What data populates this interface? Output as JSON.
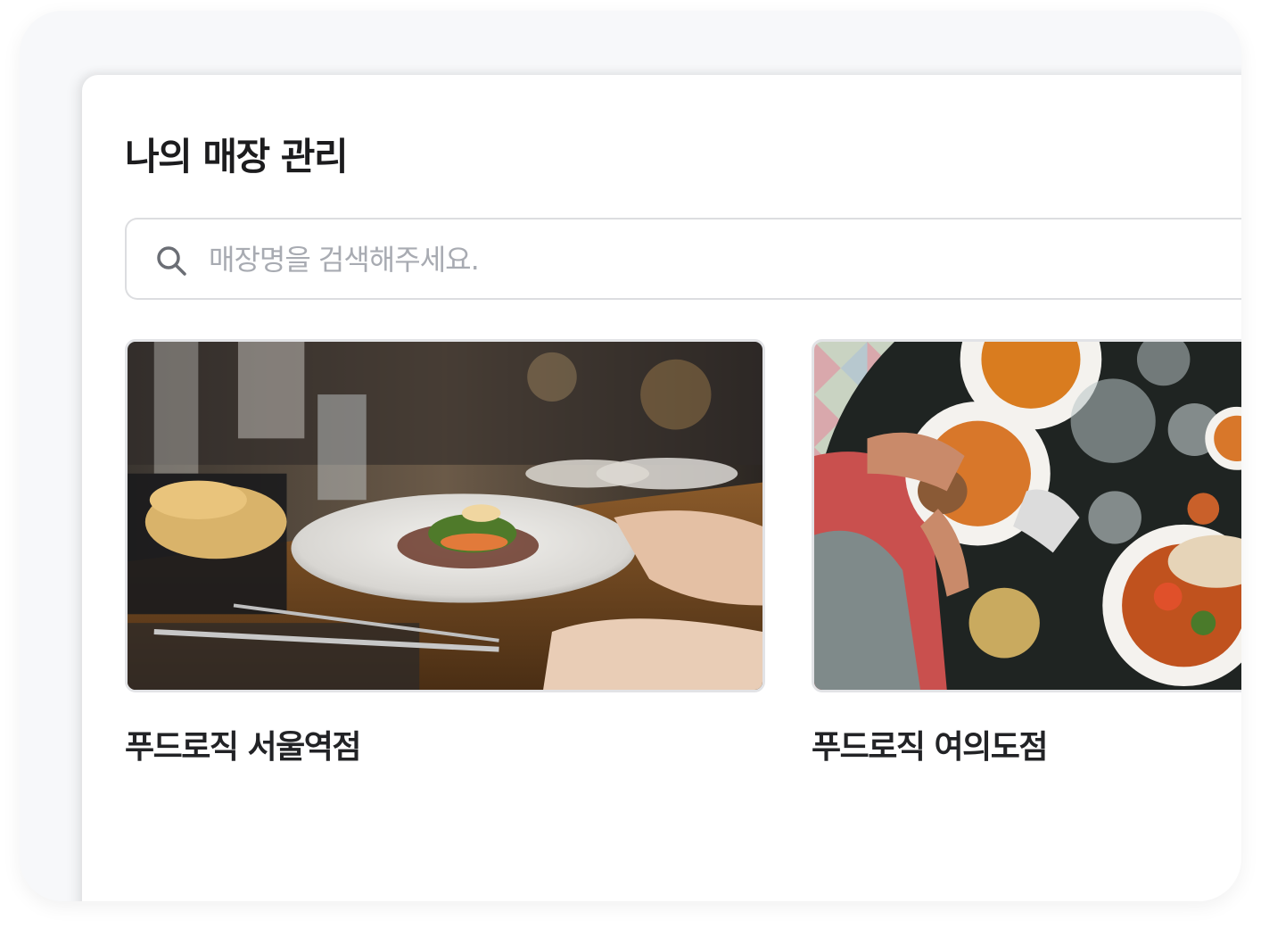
{
  "page": {
    "title": "나의 매장 관리"
  },
  "search": {
    "placeholder": "매장명을 검색해주세요.",
    "value": "",
    "icon": "search-icon"
  },
  "stores": [
    {
      "name": "푸드로직 서울역점",
      "image": "fine-dining-plate-photo"
    },
    {
      "name": "푸드로직 여의도점",
      "image": "fries-burger-table-photo"
    }
  ],
  "colors": {
    "background": "#f7f8fa",
    "panel": "#ffffff",
    "title_text": "#1c1c1e",
    "placeholder_text": "#a8abb2",
    "border": "#dcdde0"
  }
}
